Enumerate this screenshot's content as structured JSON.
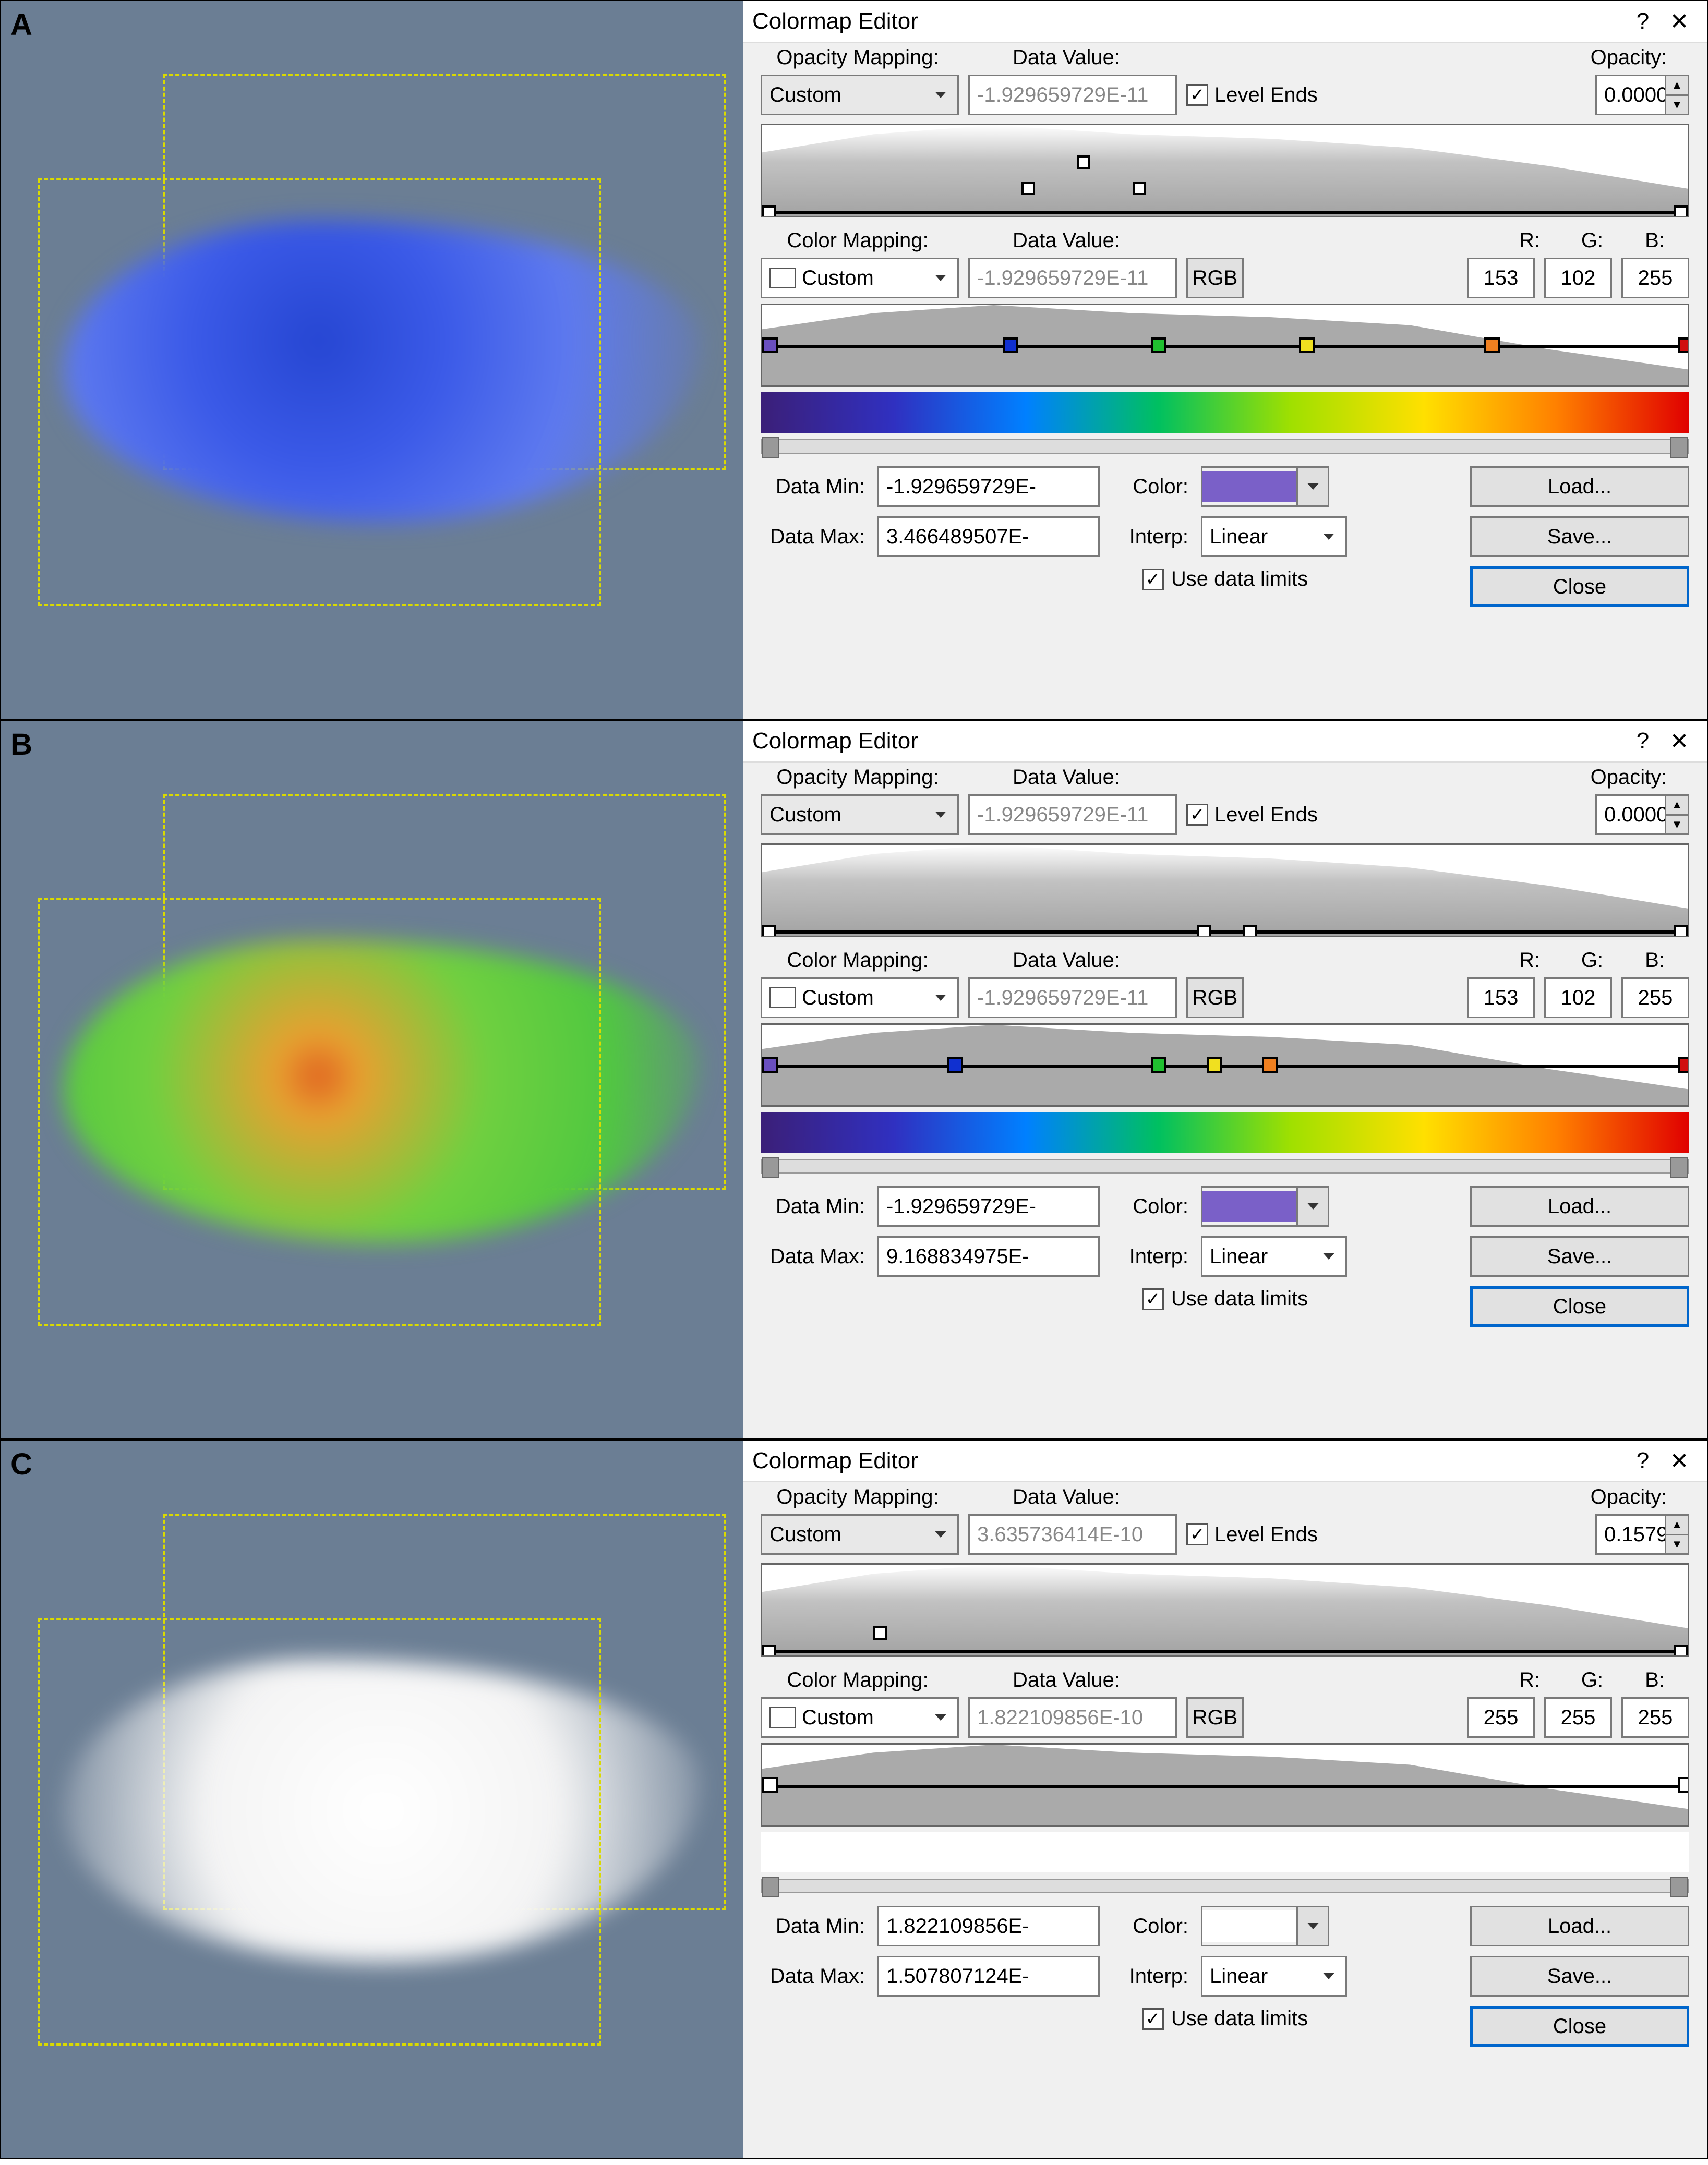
{
  "panels": {
    "A": {
      "label": "A",
      "render_color": "radial-gradient(circle at 40% 40%, #2646d2 0%, #3b5ae8 30%, #5e7aef 60%, rgba(94,122,239,0) 100%)",
      "editor": {
        "title": "Colormap Editor",
        "opacity_mapping_label": "Opacity Mapping:",
        "opacity_mapping": "Custom",
        "data_value_label": "Data Value:",
        "opacity_data_value": "-1.929659729E-11",
        "level_ends_label": "Level Ends",
        "level_ends": true,
        "opacity_label": "Opacity:",
        "opacity": "0.0000",
        "color_mapping_label": "Color Mapping:",
        "color_mapping": "Custom",
        "color_data_value": "-1.929659729E-11",
        "rgb_label": "RGB",
        "r_label": "R:",
        "g_label": "G:",
        "b_label": "B:",
        "r": "153",
        "g": "102",
        "b": "255",
        "gradient": "linear-gradient(to right, #3b1f78, #3030c0, #0080ff, #00c060, #a0e000, #ffe000, #ff8000, #e00000)",
        "strip_markers": [
          {
            "pos": 0,
            "color": "#6a4fbf"
          },
          {
            "pos": 26,
            "color": "#1030d0"
          },
          {
            "pos": 42,
            "color": "#20c030"
          },
          {
            "pos": 58,
            "color": "#f0e020"
          },
          {
            "pos": 78,
            "color": "#f08020"
          },
          {
            "pos": 99,
            "color": "#d01010"
          }
        ],
        "data_min_label": "Data Min:",
        "data_min": "-1.929659729E-",
        "data_max_label": "Data Max:",
        "data_max": "3.466489507E-",
        "color_label": "Color:",
        "selected_color": "#7a60c8",
        "interp_label": "Interp:",
        "interp": "Linear",
        "use_data_limits_label": "Use data limits",
        "use_data_limits": true,
        "load_label": "Load...",
        "save_label": "Save...",
        "close_label": "Close"
      }
    },
    "B": {
      "label": "B",
      "render_color": "radial-gradient(circle at 40% 45%, #e06020 0%, #e8a030 10%, #70d040 40%, #50c840 70%, rgba(80,200,64,0) 100%)",
      "editor": {
        "title": "Colormap Editor",
        "opacity_mapping_label": "Opacity Mapping:",
        "opacity_mapping": "Custom",
        "data_value_label": "Data Value:",
        "opacity_data_value": "-1.929659729E-11",
        "level_ends_label": "Level Ends",
        "level_ends": true,
        "opacity_label": "Opacity:",
        "opacity": "0.0000",
        "color_mapping_label": "Color Mapping:",
        "color_mapping": "Custom",
        "color_data_value": "-1.929659729E-11",
        "rgb_label": "RGB",
        "r_label": "R:",
        "g_label": "G:",
        "b_label": "B:",
        "r": "153",
        "g": "102",
        "b": "255",
        "gradient": "linear-gradient(to right, #3b1f78, #3030c0, #0080ff, #00c060, #a0e000, #ffe000, #ff8000, #e00000)",
        "strip_markers": [
          {
            "pos": 0,
            "color": "#6a4fbf"
          },
          {
            "pos": 20,
            "color": "#1030d0"
          },
          {
            "pos": 42,
            "color": "#20c030"
          },
          {
            "pos": 48,
            "color": "#f0e020"
          },
          {
            "pos": 54,
            "color": "#f08020"
          },
          {
            "pos": 99,
            "color": "#d01010"
          }
        ],
        "data_min_label": "Data Min:",
        "data_min": "-1.929659729E-",
        "data_max_label": "Data Max:",
        "data_max": "9.168834975E-",
        "color_label": "Color:",
        "selected_color": "#7a60c8",
        "interp_label": "Interp:",
        "interp": "Linear",
        "use_data_limits_label": "Use data limits",
        "use_data_limits": true,
        "load_label": "Load...",
        "save_label": "Save...",
        "close_label": "Close"
      }
    },
    "C": {
      "label": "C",
      "render_color": "radial-gradient(circle at 50% 50%, #ffffff 0%, #f4f4f4 50%, rgba(244,244,244,0) 100%)",
      "editor": {
        "title": "Colormap Editor",
        "opacity_mapping_label": "Opacity Mapping:",
        "opacity_mapping": "Custom",
        "data_value_label": "Data Value:",
        "opacity_data_value": "3.635736414E-10",
        "level_ends_label": "Level Ends",
        "level_ends": true,
        "opacity_label": "Opacity:",
        "opacity": "0.1579",
        "color_mapping_label": "Color Mapping:",
        "color_mapping": "Custom",
        "color_data_value": "1.822109856E-10",
        "rgb_label": "RGB",
        "r_label": "R:",
        "g_label": "G:",
        "b_label": "B:",
        "r": "255",
        "g": "255",
        "b": "255",
        "gradient": "linear-gradient(to right, #ffffff, #ffffff)",
        "strip_markers": [
          {
            "pos": 0,
            "color": "#ffffff"
          },
          {
            "pos": 99,
            "color": "#ffffff"
          }
        ],
        "data_min_label": "Data Min:",
        "data_min": "1.822109856E-",
        "data_max_label": "Data Max:",
        "data_max": "1.507807124E-",
        "color_label": "Color:",
        "selected_color": "#ffffff",
        "interp_label": "Interp:",
        "interp": "Linear",
        "use_data_limits_label": "Use data limits",
        "use_data_limits": true,
        "load_label": "Load...",
        "save_label": "Save...",
        "close_label": "Close"
      }
    }
  }
}
